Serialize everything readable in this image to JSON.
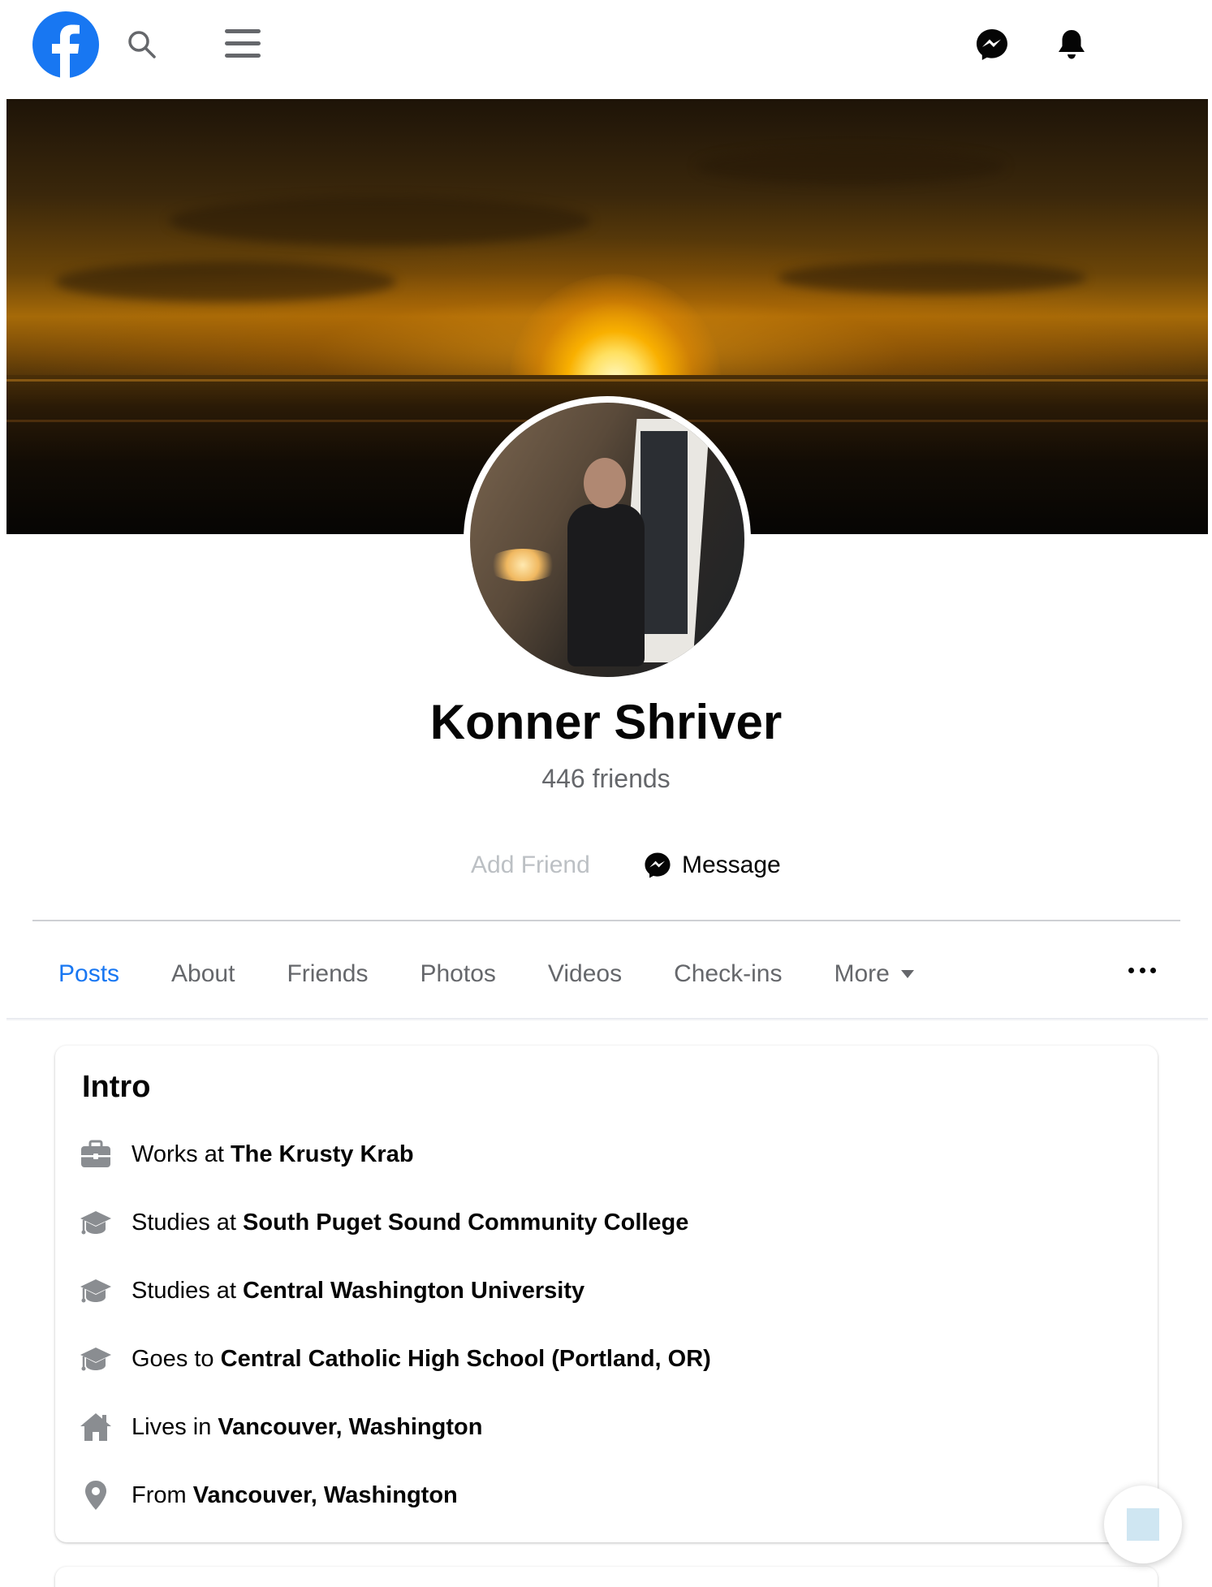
{
  "topbar": {
    "logo_icon": "facebook-logo-icon",
    "search_icon": "search-icon",
    "menu_icon": "hamburger-menu-icon",
    "messenger_icon": "messenger-icon",
    "notifications_icon": "bell-icon",
    "brand_color": "#1877f2"
  },
  "profile": {
    "name": "Konner Shriver",
    "friends_count": "446 friends",
    "add_friend_label": "Add Friend",
    "message_label": "Message"
  },
  "tabs": [
    {
      "label": "Posts",
      "active": true
    },
    {
      "label": "About",
      "active": false
    },
    {
      "label": "Friends",
      "active": false
    },
    {
      "label": "Photos",
      "active": false
    },
    {
      "label": "Videos",
      "active": false
    },
    {
      "label": "Check-ins",
      "active": false
    },
    {
      "label": "More",
      "active": false
    }
  ],
  "intro": {
    "title": "Intro",
    "items": [
      {
        "icon": "briefcase-icon",
        "prefix": "Works at ",
        "value": "The Krusty Krab"
      },
      {
        "icon": "graduation-cap-icon",
        "prefix": "Studies at ",
        "value": "South Puget Sound Community College"
      },
      {
        "icon": "graduation-cap-icon",
        "prefix": "Studies at ",
        "value": "Central Washington University"
      },
      {
        "icon": "graduation-cap-icon",
        "prefix": "Goes to ",
        "value": "Central Catholic High School (Portland, OR)"
      },
      {
        "icon": "house-icon",
        "prefix": "Lives in ",
        "value": "Vancouver, Washington"
      },
      {
        "icon": "location-pin-icon",
        "prefix": "From ",
        "value": "Vancouver, Washington"
      }
    ]
  }
}
